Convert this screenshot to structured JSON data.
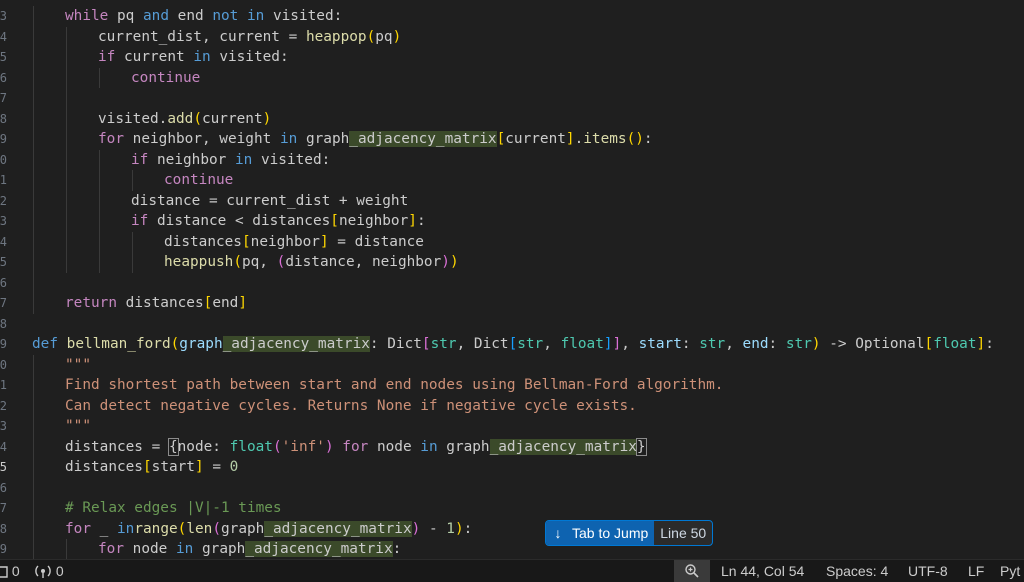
{
  "gutter": {
    "digits": [
      "3",
      "4",
      "5",
      "6",
      "7",
      "8",
      "9",
      "0",
      "1",
      "2",
      "3",
      "4",
      "5",
      "6",
      "7",
      "8",
      "9",
      "0",
      "1",
      "2",
      "3",
      "4",
      "5",
      "6",
      "7",
      "8",
      "9",
      "0"
    ],
    "active_index": 22
  },
  "code_lines": [
    {
      "indent": 1,
      "tokens": [
        [
          "ctl",
          "while"
        ],
        [
          "",
          "pq "
        ],
        [
          "kw",
          "and"
        ],
        [
          "",
          "end "
        ],
        [
          "kw",
          "not in"
        ],
        [
          "",
          "visited:"
        ]
      ]
    },
    {
      "indent": 2,
      "tokens": [
        [
          "",
          "current_dist, current = "
        ],
        [
          "fn",
          "heappop"
        ],
        [
          "b1",
          "("
        ],
        [
          "",
          "pq"
        ],
        [
          "b1",
          ")"
        ]
      ]
    },
    {
      "indent": 2,
      "tokens": [
        [
          "ctl",
          "if"
        ],
        [
          "",
          "current "
        ],
        [
          "kw",
          "in"
        ],
        [
          "",
          "visited:"
        ]
      ]
    },
    {
      "indent": 3,
      "tokens": [
        [
          "ctl",
          "continue"
        ]
      ]
    },
    {
      "indent": 0,
      "tokens": []
    },
    {
      "indent": 2,
      "tokens": [
        [
          "",
          "visited."
        ],
        [
          "fn",
          "add"
        ],
        [
          "b1",
          "("
        ],
        [
          "",
          "current"
        ],
        [
          "b1",
          ")"
        ]
      ]
    },
    {
      "indent": 2,
      "tokens": [
        [
          "ctl",
          "for"
        ],
        [
          "",
          "neighbor, weight "
        ],
        [
          "kw",
          "in"
        ],
        [
          "",
          "graph"
        ],
        [
          "hl",
          "_adjacency_matrix"
        ],
        [
          "b1",
          "["
        ],
        [
          "",
          "current"
        ],
        [
          "b1",
          "]"
        ],
        [
          "",
          "."
        ],
        [
          "fn",
          "items"
        ],
        [
          "b1",
          "()"
        ],
        [
          "",
          ":"
        ]
      ]
    },
    {
      "indent": 3,
      "tokens": [
        [
          "ctl",
          "if"
        ],
        [
          "",
          "neighbor "
        ],
        [
          "kw",
          "in"
        ],
        [
          "",
          "visited:"
        ]
      ]
    },
    {
      "indent": 4,
      "tokens": [
        [
          "ctl",
          "continue"
        ]
      ]
    },
    {
      "indent": 3,
      "tokens": [
        [
          "",
          "distance = current_dist + weight"
        ]
      ]
    },
    {
      "indent": 3,
      "tokens": [
        [
          "ctl",
          "if"
        ],
        [
          "",
          "distance < distances"
        ],
        [
          "b1",
          "["
        ],
        [
          "",
          "neighbor"
        ],
        [
          "b1",
          "]"
        ],
        [
          "",
          ":"
        ]
      ]
    },
    {
      "indent": 4,
      "tokens": [
        [
          "",
          "distances"
        ],
        [
          "b1",
          "["
        ],
        [
          "",
          "neighbor"
        ],
        [
          "b1",
          "]"
        ],
        [
          "",
          " = distance"
        ]
      ]
    },
    {
      "indent": 4,
      "tokens": [
        [
          "fn",
          "heappush"
        ],
        [
          "b1",
          "("
        ],
        [
          "",
          "pq, "
        ],
        [
          "b2",
          "("
        ],
        [
          "",
          "distance, neighbor"
        ],
        [
          "b2",
          ")"
        ],
        [
          "b1",
          ")"
        ]
      ]
    },
    {
      "indent": 0,
      "tokens": []
    },
    {
      "indent": 1,
      "tokens": [
        [
          "ctl",
          "return"
        ],
        [
          "",
          "distances"
        ],
        [
          "b1",
          "["
        ],
        [
          "",
          "end"
        ],
        [
          "b1",
          "]"
        ]
      ]
    },
    {
      "indent": 0,
      "tokens": []
    },
    {
      "indent": 0,
      "tokens": [
        [
          "kw",
          "def "
        ],
        [
          "fn",
          "bellman_ford"
        ],
        [
          "b1",
          "("
        ],
        [
          "vr",
          "graph"
        ],
        [
          "hl",
          "_adjacency_matrix"
        ],
        [
          "",
          ": Dict"
        ],
        [
          "b2",
          "["
        ],
        [
          "ty",
          "str"
        ],
        [
          "",
          ", Dict"
        ],
        [
          "b3",
          "["
        ],
        [
          "ty",
          "str"
        ],
        [
          "",
          ", "
        ],
        [
          "ty",
          "float"
        ],
        [
          "b3",
          "]"
        ],
        [
          "b2",
          "]"
        ],
        [
          "",
          ", "
        ],
        [
          "vr",
          "start"
        ],
        [
          "",
          ": "
        ],
        [
          "ty",
          "str"
        ],
        [
          "",
          ", "
        ],
        [
          "vr",
          "end"
        ],
        [
          "",
          ": "
        ],
        [
          "ty",
          "str"
        ],
        [
          "b1",
          ")"
        ],
        [
          "",
          " -> Optional"
        ],
        [
          "b1",
          "["
        ],
        [
          "ty",
          "float"
        ],
        [
          "b1",
          "]"
        ],
        [
          "",
          ":"
        ]
      ]
    },
    {
      "indent": 1,
      "tokens": [
        [
          "str",
          "\"\"\""
        ]
      ]
    },
    {
      "indent": 1,
      "tokens": [
        [
          "str",
          "Find shortest path between start and end nodes using Bellman-Ford algorithm."
        ]
      ]
    },
    {
      "indent": 1,
      "tokens": [
        [
          "str",
          "Can detect negative cycles. Returns None if negative cycle exists."
        ]
      ]
    },
    {
      "indent": 1,
      "tokens": [
        [
          "str",
          "\"\"\""
        ]
      ]
    },
    {
      "indent": 1,
      "tokens": [
        [
          "",
          "distances = "
        ],
        [
          "bm",
          "{"
        ],
        [
          "",
          "node: "
        ],
        [
          "ty",
          "float"
        ],
        [
          "b2",
          "("
        ],
        [
          "str",
          "'inf'"
        ],
        [
          "b2",
          ")"
        ],
        [
          "ctl",
          " for "
        ],
        [
          "",
          "node "
        ],
        [
          "kw",
          "in"
        ],
        [
          "",
          "graph"
        ],
        [
          "hl",
          "_adjacency_matrix"
        ],
        [
          "bm",
          "}"
        ]
      ]
    },
    {
      "indent": 1,
      "tokens": [
        [
          "",
          "distances"
        ],
        [
          "b1",
          "["
        ],
        [
          "",
          "start"
        ],
        [
          "b1",
          "]"
        ],
        [
          "",
          " = "
        ],
        [
          "num",
          "0"
        ]
      ]
    },
    {
      "indent": 0,
      "tokens": []
    },
    {
      "indent": 1,
      "tokens": [
        [
          "cmt",
          "# Relax edges |V|-1 times"
        ]
      ]
    },
    {
      "indent": 1,
      "tokens": [
        [
          "ctl",
          "for"
        ],
        [
          "",
          " _ "
        ],
        [
          "kw",
          "in"
        ],
        [
          "",
          ""
        ],
        [
          "fn",
          "range"
        ],
        [
          "b1",
          "("
        ],
        [
          "fn",
          "len"
        ],
        [
          "b2",
          "("
        ],
        [
          "",
          "graph"
        ],
        [
          "hl",
          "_adjacency_matrix"
        ],
        [
          "b2",
          ")"
        ],
        [
          "",
          " - "
        ],
        [
          "num",
          "1"
        ],
        [
          "b1",
          ")"
        ],
        [
          "",
          ":"
        ]
      ]
    },
    {
      "indent": 2,
      "tokens": [
        [
          "ctl",
          "for"
        ],
        [
          "",
          "node "
        ],
        [
          "kw",
          "in"
        ],
        [
          "",
          "graph"
        ],
        [
          "hl",
          "_adjacency_matrix"
        ],
        [
          "",
          ":"
        ]
      ]
    }
  ],
  "jump_hint": {
    "arrow": "↓",
    "label": "Tab to Jump",
    "line": "Line 50"
  },
  "status": {
    "errors": "0",
    "ports": "0",
    "position": "Ln 44, Col 54",
    "spaces": "Spaces: 4",
    "encoding": "UTF-8",
    "eol": "LF",
    "language": "Pyt"
  }
}
